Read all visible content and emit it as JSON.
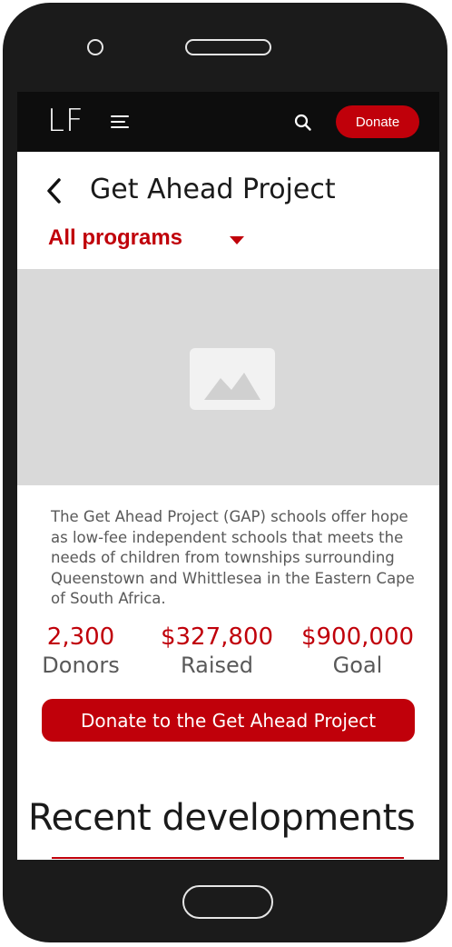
{
  "navbar": {
    "logo": "LF",
    "menu_icon": "hamburger-menu-icon",
    "search_icon": "search-icon",
    "donate_label": "Donate"
  },
  "page": {
    "back_icon": "chevron-left-icon",
    "title": "Get Ahead Project",
    "filter_label": "All programs",
    "filter_icon": "caret-down-icon"
  },
  "hero": {
    "image_icon": "image-placeholder-icon"
  },
  "description": "The Get Ahead Project (GAP) schools offer hope as low-fee independent schools that meets the needs of children from townships surrounding Queenstown and Whittlesea in the Eastern Cape of South Africa.",
  "stats": [
    {
      "value": "2,300",
      "label": "Donors"
    },
    {
      "value": "$327,800",
      "label": "Raised"
    },
    {
      "value": "$900,000",
      "label": "Goal"
    }
  ],
  "cta_label": "Donate to the Get Ahead Project",
  "recent_heading": "Recent developments",
  "colors": {
    "accent": "#c0000a",
    "navbar": "#0d0d0d",
    "placeholder": "#d9d9d9"
  }
}
